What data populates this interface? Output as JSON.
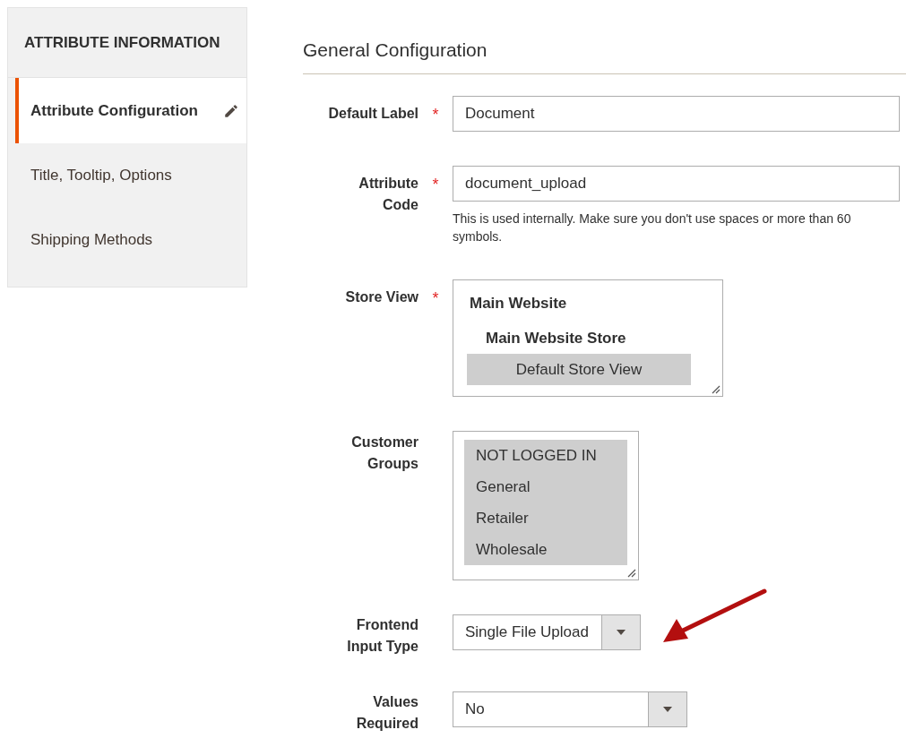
{
  "sidebar": {
    "title": "ATTRIBUTE INFORMATION",
    "items": [
      {
        "label": "Attribute Configuration",
        "selected": true
      },
      {
        "label": "Title, Tooltip, Options",
        "selected": false
      },
      {
        "label": "Shipping Methods",
        "selected": false
      }
    ]
  },
  "section": {
    "title": "General Configuration"
  },
  "fields": [
    {
      "kind": "text",
      "label": "Default Label",
      "required_mark": "*",
      "value": "Document"
    },
    {
      "kind": "text",
      "label": "Attribute Code",
      "required_mark": "*",
      "value": "document_upload",
      "note": "This is used internally. Make sure you don't use spaces or more than 60 symbols."
    },
    {
      "kind": "tree-select",
      "label": "Store View",
      "required_mark": "*",
      "options": [
        {
          "label": "Main Website",
          "children": [
            {
              "label": "Main Website Store",
              "children": [
                {
                  "label": "Default Store View",
                  "selected": true
                }
              ]
            }
          ]
        }
      ]
    },
    {
      "kind": "multi-select",
      "label": "Customer Groups",
      "options": [
        {
          "label": "NOT LOGGED IN",
          "selected": true
        },
        {
          "label": "General",
          "selected": true
        },
        {
          "label": "Retailer",
          "selected": true
        },
        {
          "label": "Wholesale",
          "selected": true
        }
      ]
    },
    {
      "kind": "select",
      "label": "Frontend Input Type",
      "value": "Single File Upload"
    },
    {
      "kind": "select",
      "label": "Values Required",
      "value": "No"
    }
  ]
}
